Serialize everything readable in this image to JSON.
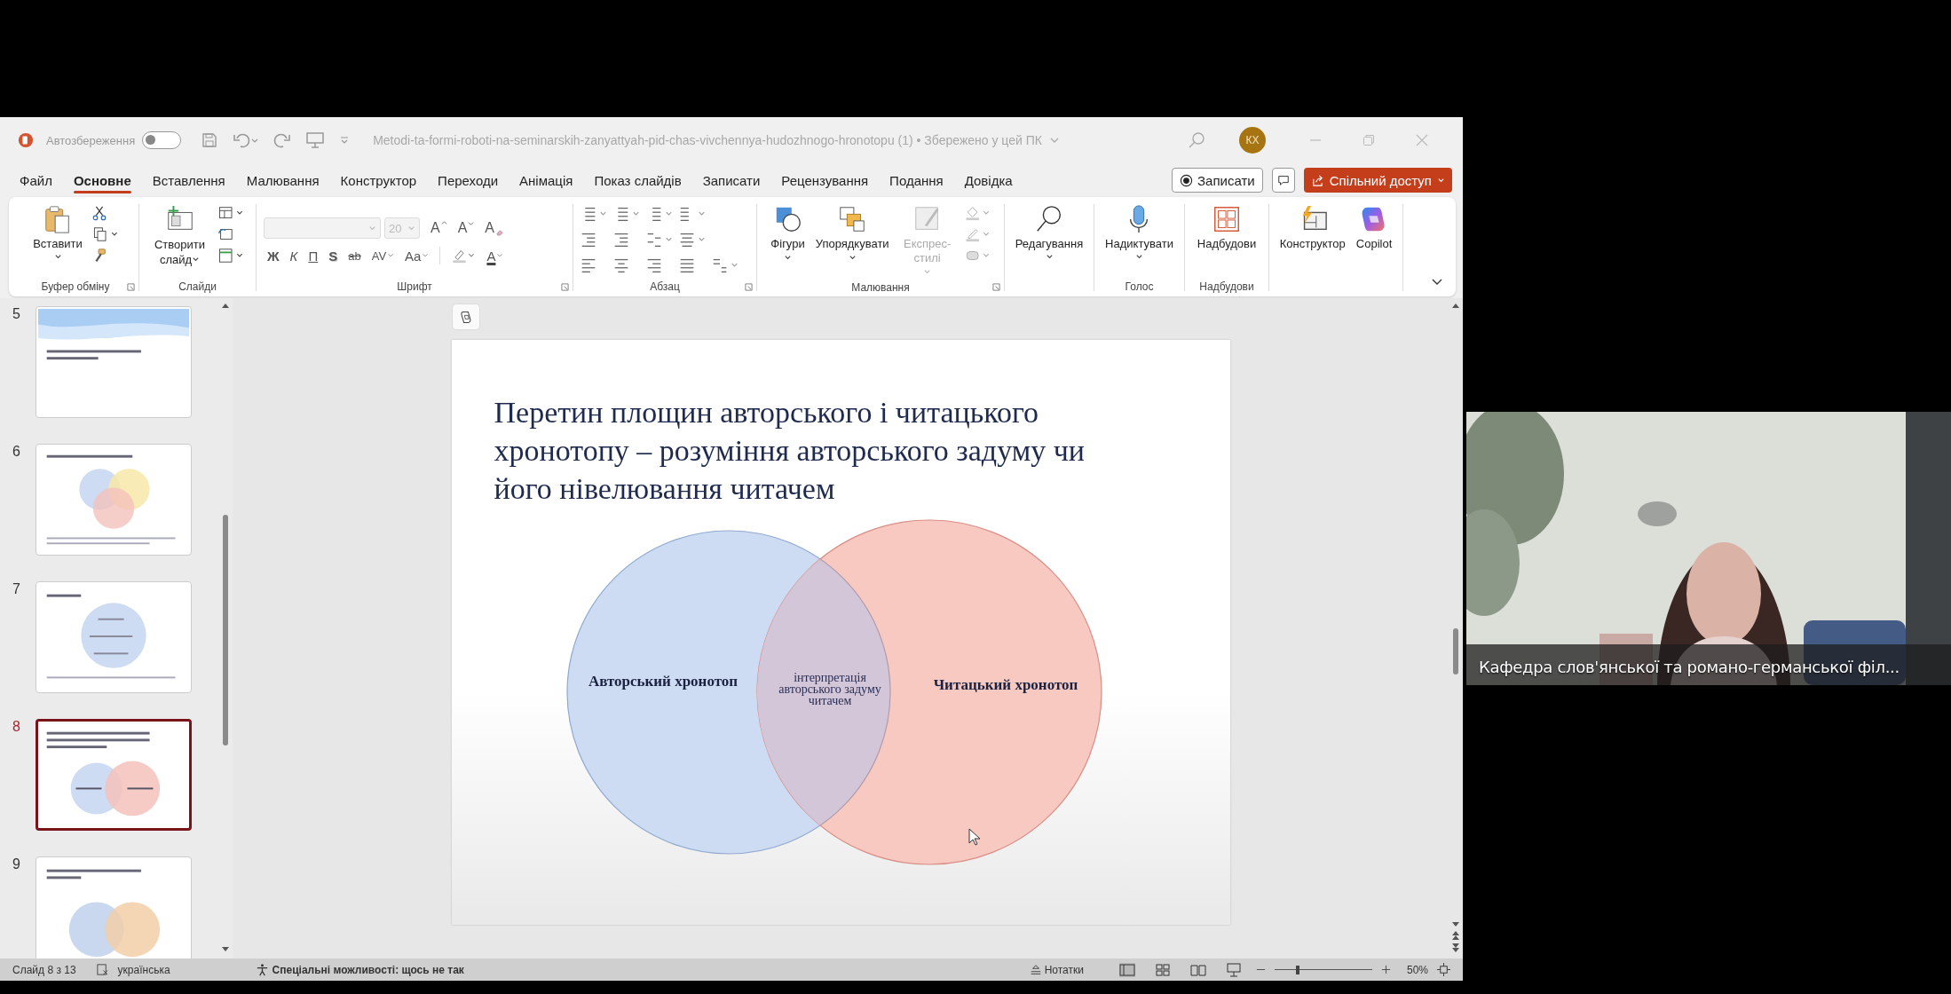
{
  "title_bar": {
    "autosave_label": "Автозбереження",
    "autosave_on": false,
    "document_title": "Metodi-ta-formi-roboti-na-seminarskih-zanyattyah-pid-chas-vivchennya-hudozhnogo-hronotopu (1) • Збережено у цей ПК",
    "avatar": "КХ"
  },
  "tabs": [
    {
      "label": "Файл",
      "selected": false
    },
    {
      "label": "Основне",
      "selected": true
    },
    {
      "label": "Вставлення",
      "selected": false
    },
    {
      "label": "Малювання",
      "selected": false
    },
    {
      "label": "Конструктор",
      "selected": false
    },
    {
      "label": "Переходи",
      "selected": false
    },
    {
      "label": "Анімація",
      "selected": false
    },
    {
      "label": "Показ слайдів",
      "selected": false
    },
    {
      "label": "Записати",
      "selected": false
    },
    {
      "label": "Рецензування",
      "selected": false
    },
    {
      "label": "Подання",
      "selected": false
    },
    {
      "label": "Довідка",
      "selected": false
    }
  ],
  "actions": {
    "record": "Записати",
    "share": "Спільний доступ"
  },
  "ribbon": {
    "clipboard": {
      "paste": "Вставити",
      "group": "Буфер обміну"
    },
    "slides": {
      "new_slide": "Створити слайд",
      "group": "Слайди"
    },
    "font": {
      "font_size": "20",
      "size_buttons": [
        "A",
        "A",
        "A"
      ],
      "format_buttons": [
        "Ж",
        "К",
        "П",
        "S",
        "ab",
        "AV",
        "Aa"
      ],
      "color_button": "A",
      "group": "Шрифт"
    },
    "paragraph": {
      "group": "Абзац"
    },
    "drawing": {
      "commands": [
        {
          "label": "Фігури",
          "disabled": false
        },
        {
          "label": "Упорядкувати",
          "disabled": false
        },
        {
          "label": "Експрес-стилі",
          "disabled": true
        }
      ],
      "group": "Малювання"
    },
    "editing": {
      "label": "Редагування"
    },
    "voice": {
      "label": "Надиктувати",
      "group": "Голос"
    },
    "addins": {
      "label": "Надбудови",
      "group": "Надбудови"
    },
    "designer": "Конструктор",
    "copilot": "Copilot"
  },
  "slides": [
    {
      "number": "5",
      "selected": false
    },
    {
      "number": "6",
      "selected": false
    },
    {
      "number": "7",
      "selected": false
    },
    {
      "number": "8",
      "selected": true
    },
    {
      "number": "9",
      "selected": false
    }
  ],
  "slide": {
    "title": "Перетин площин авторського і читацького хронотопу – розуміння авторського задуму чи його нівелювання читачем",
    "venn": {
      "circles": [
        {
          "label": "Авторський хронотоп",
          "color": "#cddcf2"
        },
        {
          "label": "Читацький хронотоп",
          "color": "#f7c9c1"
        }
      ],
      "overlap_label": [
        "інтерпретація",
        "авторського задуму",
        "читачем"
      ]
    }
  },
  "status_bar": {
    "slide_info": "Слайд 8 з 13",
    "language": "українська",
    "accessibility": "Спеціальні можливості: щось не так",
    "notes": "Нотатки",
    "zoom_slider": {
      "level": 0.24
    },
    "zoom": "50%"
  },
  "video": {
    "name": "Кафедра слов'янської та романо-германської філ..."
  }
}
